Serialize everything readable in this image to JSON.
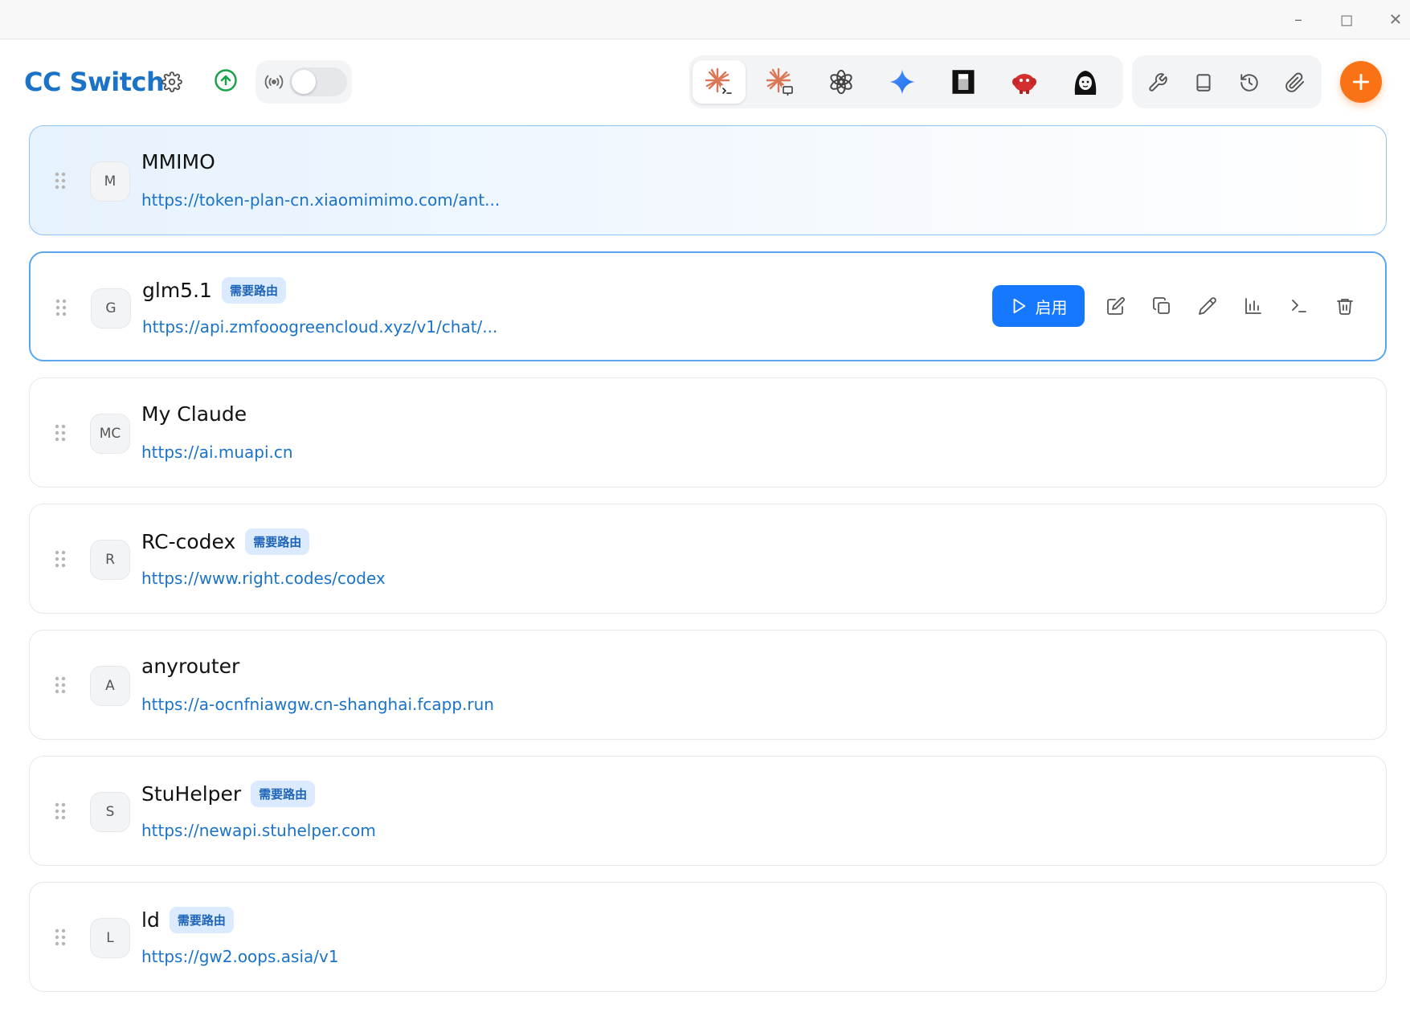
{
  "window": {
    "minimize_glyph": "–",
    "maximize_glyph": "◻",
    "close_glyph": "✕"
  },
  "header": {
    "title": "CC Switch",
    "icons": [
      "gear-icon",
      "upload-icon",
      "proxy-broadcast-icon"
    ],
    "proxy_toggle_on": false,
    "app_tabs": [
      {
        "name": "claude-code-icon",
        "active": true
      },
      {
        "name": "claude-desktop-icon",
        "active": false
      },
      {
        "name": "openai-icon",
        "active": false
      },
      {
        "name": "gemini-icon",
        "active": false
      },
      {
        "name": "opencode-icon",
        "active": false
      },
      {
        "name": "red-mascot-icon",
        "active": false
      },
      {
        "name": "character-avatar-icon",
        "active": false
      }
    ],
    "tools": [
      "wrench-icon",
      "book-icon",
      "history-icon",
      "paperclip-icon"
    ],
    "add_glyph": "+"
  },
  "colors": {
    "accent": "#1a73c8",
    "primary_button": "#1677ff",
    "add_button": "#f97316",
    "badge_bg": "#dbeafe",
    "badge_text": "#1d64b8",
    "upload_green": "#16a34a"
  },
  "providers": [
    {
      "initials": "M",
      "name": "MMIMO",
      "badge": "",
      "url": "https://token-plan-cn.xiaomimimo.com/ant...",
      "current": true
    },
    {
      "initials": "G",
      "name": "glm5.1",
      "badge": "需要路由",
      "url": "https://api.zmfooogreencloud.xyz/v1/chat/...",
      "hover": true
    },
    {
      "initials": "MC",
      "name": "My Claude",
      "badge": "",
      "url": "https://ai.muapi.cn"
    },
    {
      "initials": "R",
      "name": "RC-codex",
      "badge": "需要路由",
      "url": "https://www.right.codes/codex"
    },
    {
      "initials": "A",
      "name": "anyrouter",
      "badge": "",
      "url": "https://a-ocnfniawgw.cn-shanghai.fcapp.run"
    },
    {
      "initials": "S",
      "name": "StuHelper",
      "badge": "需要路由",
      "url": "https://newapi.stuhelper.com"
    },
    {
      "initials": "L",
      "name": "ld",
      "badge": "需要路由",
      "url": "https://gw2.oops.asia/v1"
    }
  ],
  "card_actions": {
    "enable_label": "启用",
    "icons": [
      "edit-icon",
      "duplicate-icon",
      "pen-icon",
      "usage-chart-icon",
      "terminal-icon",
      "trash-icon"
    ]
  }
}
